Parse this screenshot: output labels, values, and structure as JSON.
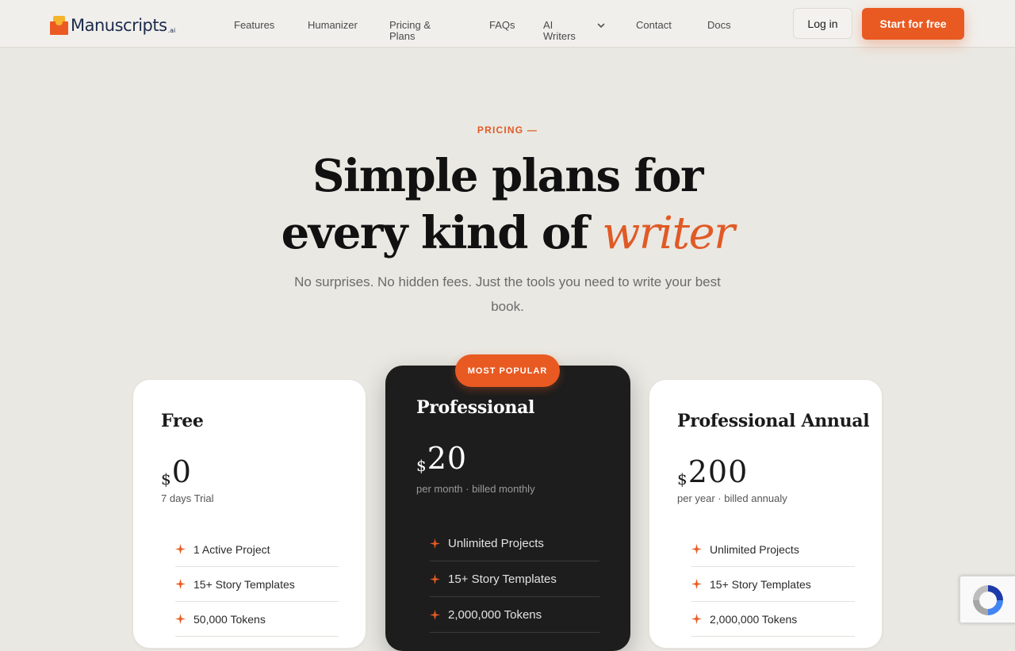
{
  "header": {
    "logo_text": "Manuscripts",
    "logo_suffix": ".ai",
    "nav": [
      {
        "label": "Features"
      },
      {
        "label": "Humanizer"
      },
      {
        "label": "Pricing & Plans"
      },
      {
        "label": "FAQs"
      },
      {
        "label": "AI Writers"
      },
      {
        "label": "Contact"
      },
      {
        "label": "Docs"
      }
    ],
    "login_label": "Log in",
    "start_label": "Start for free"
  },
  "hero": {
    "eyebrow": "PRICING —",
    "headline_line1": "Simple plans for",
    "headline_line2": "every kind of ",
    "headline_accent": "writer",
    "subtitle": "No surprises. No hidden fees. Just the tools you need to write your best book."
  },
  "plans": [
    {
      "name": "Free",
      "currency": "$",
      "price": "0",
      "billing": "7 days Trial",
      "features": [
        "1 Active Project",
        "15+ Story Templates",
        "50,000 Tokens"
      ]
    },
    {
      "name": "Professional",
      "badge": "MOST POPULAR",
      "currency": "$",
      "price": "20",
      "billing": "per month · billed monthly",
      "features": [
        "Unlimited Projects",
        "15+ Story Templates",
        "2,000,000 Tokens"
      ]
    },
    {
      "name": "Professional Annual",
      "currency": "$",
      "price": "200",
      "billing": "per year · billed annualy",
      "features": [
        "Unlimited Projects",
        "15+ Story Templates",
        "2,000,000 Tokens"
      ]
    }
  ],
  "colors": {
    "accent": "#e85a22",
    "background": "#eae8e2",
    "dark_card": "#1d1d1d"
  }
}
